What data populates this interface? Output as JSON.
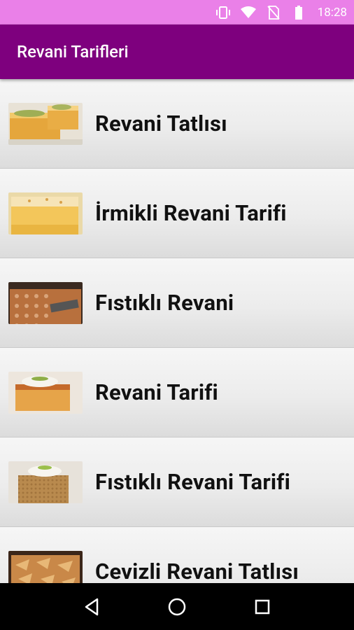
{
  "status_bar": {
    "time": "18:28"
  },
  "app_bar": {
    "title": "Revani Tarifleri"
  },
  "colors": {
    "status_bar": "#ea80e8",
    "app_bar": "#7e007e",
    "nav_bar": "#000000"
  },
  "recipes": [
    {
      "label": "Revani Tatlısı",
      "image": "revani-slices-photo"
    },
    {
      "label": "İrmikli Revani Tarifi",
      "image": "semolina-revani-photo"
    },
    {
      "label": "Fıstıklı Revani",
      "image": "pistachio-revani-tray-photo"
    },
    {
      "label": "Revani Tarifi",
      "image": "revani-with-cream-photo"
    },
    {
      "label": "Fıstıklı Revani Tarifi",
      "image": "pistachio-revani-slice-photo"
    },
    {
      "label": "Cevizli Revani Tatlısı",
      "image": "walnut-revani-photo"
    }
  ],
  "nav": [
    "back-icon",
    "home-icon",
    "recents-icon"
  ]
}
